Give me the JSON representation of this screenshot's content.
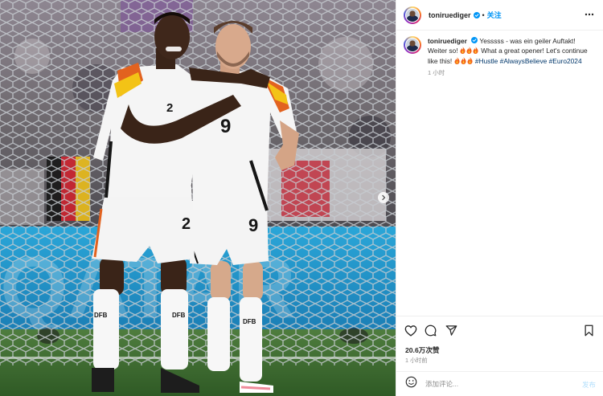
{
  "colors": {
    "accent": "#0095f6",
    "hashtag": "#00376b",
    "muted": "#8e8e8e",
    "text": "#262626",
    "post_disabled": "#b2dffc"
  },
  "post": {
    "photo": {
      "jersey_numbers": [
        "2",
        "9",
        "2",
        "9"
      ],
      "badge_text": "DFB",
      "carousel_next_icon": "chevron-right-icon"
    },
    "header": {
      "username": "toniruediger",
      "separator": "•",
      "follow_label": "关注",
      "more_icon": "ellipsis-icon"
    },
    "caption": {
      "username": "toniruediger",
      "text_1": "Yesssss - was ein geiler Auftakt! Weiter so!",
      "text_2": "What a great opener! Let's continue like this!",
      "hashtags": [
        "#Hustle",
        "#AlwaysBelieve",
        "#Euro2024"
      ],
      "time": "1 小时"
    },
    "actions": {
      "icons": [
        "heart-icon",
        "comment-icon",
        "share-icon",
        "bookmark-icon"
      ],
      "likes": "20.6万次赞",
      "time": "1 小时前"
    },
    "comment": {
      "placeholder": "添加评论...",
      "post_label": "发布",
      "emoji_icon": "emoji-icon"
    }
  }
}
